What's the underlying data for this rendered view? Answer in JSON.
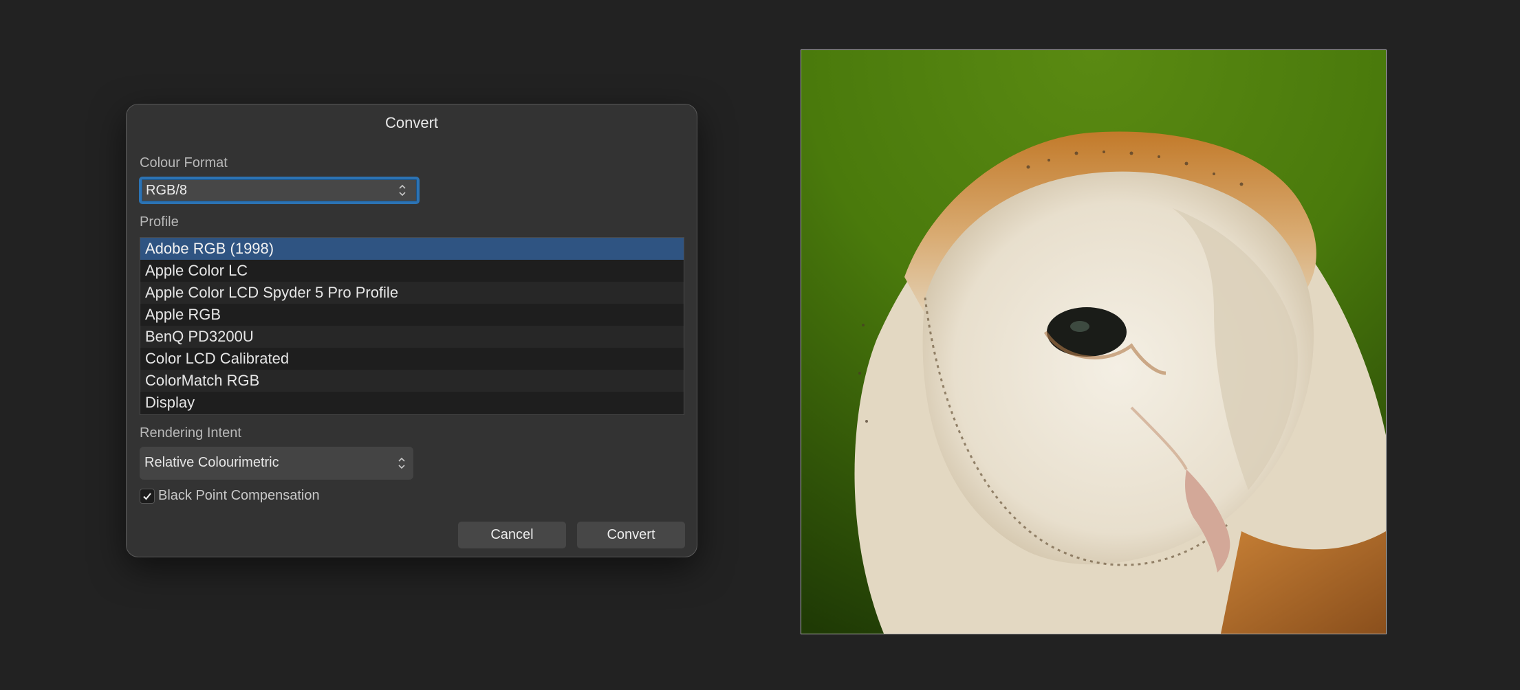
{
  "dialog": {
    "title": "Convert",
    "colour_format": {
      "label": "Colour Format",
      "value": "RGB/8"
    },
    "profile": {
      "label": "Profile",
      "items": [
        "Adobe RGB (1998)",
        "Apple Color LC",
        "Apple Color LCD Spyder 5 Pro Profile",
        "Apple RGB",
        "BenQ PD3200U",
        "Color LCD Calibrated",
        "ColorMatch RGB",
        "Display"
      ],
      "selected": "Adobe RGB (1998)"
    },
    "rendering_intent": {
      "label": "Rendering Intent",
      "value": "Relative Colourimetric"
    },
    "black_point": {
      "label": "Black Point Compensation",
      "checked": true
    },
    "buttons": {
      "cancel": "Cancel",
      "convert": "Convert"
    }
  },
  "colors": {
    "background": "#222222",
    "dialog": "#333333",
    "accent": "#2c73b4",
    "selection": "#2f5482"
  },
  "preview": {
    "subject": "barn owl photo"
  }
}
